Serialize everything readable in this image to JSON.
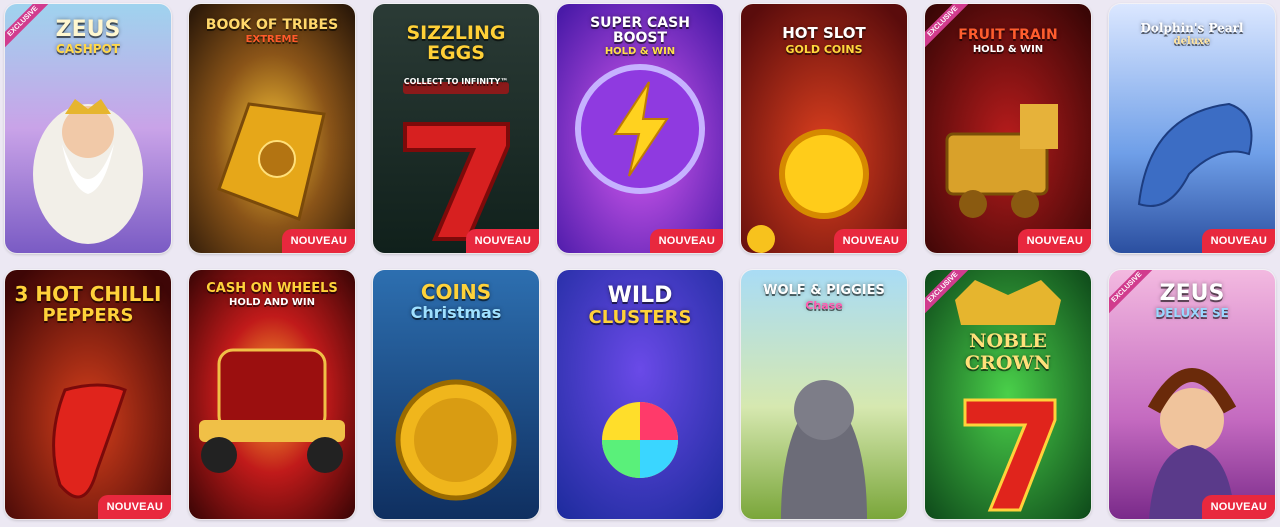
{
  "badges": {
    "new": "NOUVEAU",
    "exclusive": "EXCLUSIVE"
  },
  "games": [
    {
      "t1": "ZEUS",
      "t2": "CASHPOT",
      "badge": false,
      "exclusive": true
    },
    {
      "t1": "BOOK OF TRIBES",
      "t2": "EXTREME",
      "badge": true,
      "exclusive": false
    },
    {
      "t1": "SIZZLING EGGS",
      "t2": "COLLECT TO INFINITY™",
      "badge": true,
      "exclusive": false
    },
    {
      "t1": "SUPER CASH BOOST",
      "t2": "HOLD & WIN",
      "badge": true,
      "exclusive": false
    },
    {
      "t1": "HOT SLOT",
      "t2": "GOLD COINS",
      "badge": true,
      "exclusive": false
    },
    {
      "t1": "FRUIT TRAIN",
      "t2": "HOLD & WIN",
      "badge": true,
      "exclusive": true
    },
    {
      "t1": "Dolphin's Pearl",
      "t2": "deluxe",
      "badge": true,
      "exclusive": false
    },
    {
      "t1": "3 HOT CHILLI",
      "t2": "PEPPERS",
      "badge": true,
      "exclusive": false
    },
    {
      "t1": "CASH ON WHEELS",
      "t2": "HOLD AND WIN",
      "badge": false,
      "exclusive": false
    },
    {
      "t1": "COINS",
      "t2": "Christmas",
      "badge": false,
      "exclusive": false
    },
    {
      "t1": "WILD",
      "t2": "CLUSTERS",
      "badge": false,
      "exclusive": false
    },
    {
      "t1": "WOLF & PIGGIES",
      "t2": "Chase",
      "badge": false,
      "exclusive": false
    },
    {
      "t1": "NOBLE",
      "t2": "CROWN",
      "badge": false,
      "exclusive": true
    },
    {
      "t1": "ZEUS",
      "t2": "DELUXE SE",
      "badge": true,
      "exclusive": true
    }
  ]
}
